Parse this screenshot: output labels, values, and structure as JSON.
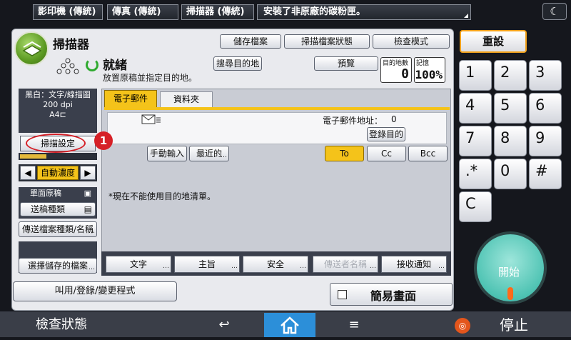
{
  "topbar": {
    "tabs": [
      "影印機 (傳統)",
      "傳真 (傳統)",
      "掃描器 (傳統)"
    ],
    "message": "安裝了非原廠的碳粉匣。",
    "moon_icon": "moon-icon"
  },
  "header": {
    "title": "掃描器",
    "buttons": {
      "stored_file": "儲存檔案",
      "file_status": "掃描檔案狀態",
      "check_mode": "檢查模式"
    },
    "search_dest": "搜尋目的地",
    "preview": "預覽"
  },
  "status": {
    "ready": "就緒",
    "sub": "放置原稿並指定目的地。",
    "dest_count_label": "目的地數",
    "dest_count": "0",
    "memory_label": "記憶",
    "memory": "100%"
  },
  "left": {
    "info": [
      "黑白：文字/線描圖",
      "200 dpi",
      "A4"
    ],
    "scan_settings": "掃描設定",
    "density_fill": 0.35,
    "density_left": "◀",
    "density_right": "▶",
    "auto_density": "自動濃度",
    "simplex": "單面原稿",
    "send_type": "送稿種類",
    "file_type": "傳送檔案種類/名稱",
    "select_save": "選擇儲存的檔案"
  },
  "tabs": {
    "email": "電子郵件",
    "folder": "資料夾"
  },
  "address": {
    "label": "電子郵件地址：",
    "count": "0",
    "register": "登錄目的"
  },
  "entry": {
    "manual": "手動輸入",
    "recent": "最近的"
  },
  "recipients": {
    "to": "To",
    "cc": "Cc",
    "bcc": "Bcc"
  },
  "note": "*現在不能使用目的地清單。",
  "bottom_tabs": {
    "text": "文字",
    "subject": "主旨",
    "security": "安全",
    "sender": "傳送者名稱",
    "notify": "接收通知"
  },
  "call_program": "叫用/登錄/變更程式",
  "simple_screen": "簡易畫面",
  "annotation": "1",
  "keypad": {
    "reset": "重設",
    "keys": [
      "1",
      "2",
      "3",
      "4",
      "5",
      "6",
      "7",
      "8",
      "9",
      ".*",
      "0",
      "#",
      "C"
    ],
    "start": "開始",
    "accent": "#4ec3b3"
  },
  "bottombar": {
    "check_status": "檢查狀態",
    "back": "↩",
    "home": "⌂",
    "menu": "≡",
    "stop": "停止"
  }
}
